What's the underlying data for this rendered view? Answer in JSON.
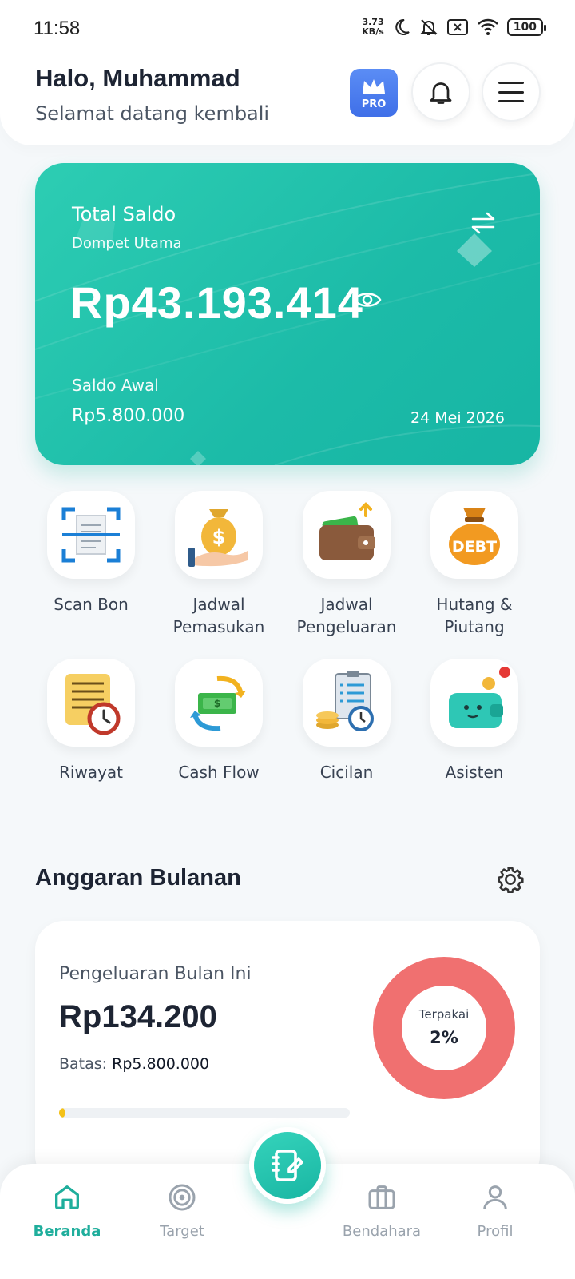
{
  "status_bar": {
    "time": "11:58",
    "speed_value": "3.73",
    "speed_unit": "KB/s",
    "battery": "100"
  },
  "header": {
    "greeting": "Halo, Muhammad",
    "subtitle": "Selamat datang kembali",
    "pro_label": "PRO"
  },
  "balance_card": {
    "title": "Total Saldo",
    "wallet_name": "Dompet Utama",
    "amount": "Rp43.193.414",
    "initial_label": "Saldo Awal",
    "initial_value": "Rp5.800.000",
    "date": "24 Mei 2026",
    "color": "#1fc0ab"
  },
  "quick_menu": [
    {
      "label": "Scan Bon",
      "icon": "scan-receipt-icon"
    },
    {
      "label": "Jadwal Pemasukan",
      "icon": "money-bag-hand-icon"
    },
    {
      "label": "Jadwal Pengeluaran",
      "icon": "wallet-out-icon"
    },
    {
      "label": "Hutang & Piutang",
      "icon": "debt-bag-icon"
    },
    {
      "label": "Riwayat",
      "icon": "history-scroll-icon"
    },
    {
      "label": "Cash Flow",
      "icon": "cash-cycle-icon"
    },
    {
      "label": "Cicilan",
      "icon": "installment-icon"
    },
    {
      "label": "Asisten",
      "icon": "wallet-assistant-icon"
    }
  ],
  "budget": {
    "title": "Anggaran Bulanan",
    "spend_label": "Pengeluaran Bulan Ini",
    "spend_amount": "Rp134.200",
    "limit_label": "Batas:",
    "limit_value": "Rp5.800.000",
    "used_label": "Terpakai",
    "used_percent": "2%",
    "used_fraction": 0.02,
    "donut_color": "#f07070",
    "progress_color": "#f4c118"
  },
  "bottom_nav": {
    "items": [
      {
        "label": "Beranda",
        "icon": "home-icon",
        "active": true
      },
      {
        "label": "Target",
        "icon": "target-icon",
        "active": false
      },
      {
        "label": "Bendahara",
        "icon": "briefcase-icon",
        "active": false
      },
      {
        "label": "Profil",
        "icon": "profile-icon",
        "active": false
      }
    ],
    "fab_icon": "notebook-edit-icon",
    "active_color": "#1fae9c"
  }
}
